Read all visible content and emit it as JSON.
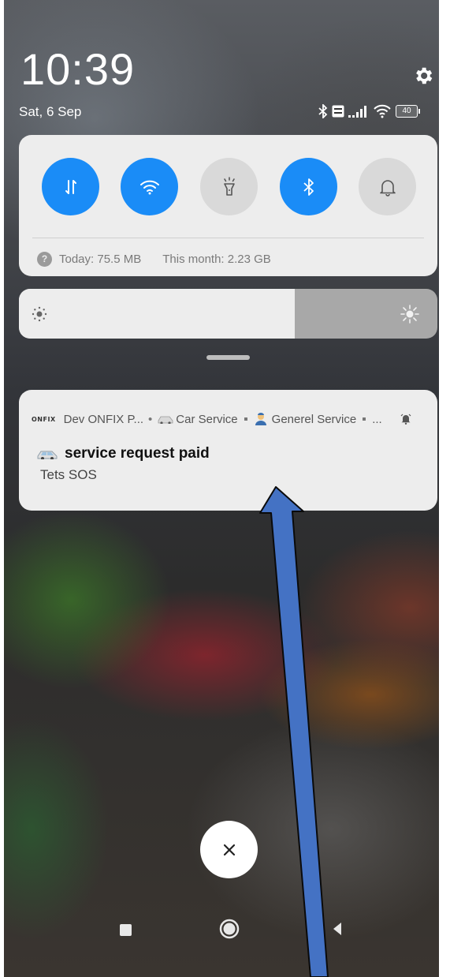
{
  "status_bar": {
    "time": "10:39",
    "date": "Sat, 6 Sep",
    "battery": "40",
    "icons": [
      "bluetooth-icon",
      "volte-icon",
      "signal-icon",
      "wifi-icon",
      "battery-icon"
    ]
  },
  "quick_settings": {
    "toggles": [
      {
        "icon": "mobile-data-icon",
        "state": "on"
      },
      {
        "icon": "wifi-icon",
        "state": "on"
      },
      {
        "icon": "flashlight-icon",
        "state": "off"
      },
      {
        "icon": "bluetooth-icon",
        "state": "on"
      },
      {
        "icon": "bell-icon",
        "state": "off"
      }
    ],
    "data_today": "Today: 75.5 MB",
    "data_month": "This month: 2.23 GB"
  },
  "brightness": {
    "level": 0.66
  },
  "notification": {
    "app_logo": "ONFIX",
    "app_name": "Dev ONFIX P...",
    "channel_1": "Car Service",
    "channel_2": "Generel Service",
    "more": "...",
    "title": "service request paid",
    "subtitle": "Tets SOS"
  },
  "colors": {
    "accent": "#1a8cf7",
    "panel": "#ededed",
    "annotation_arrow": "#4472c4"
  }
}
